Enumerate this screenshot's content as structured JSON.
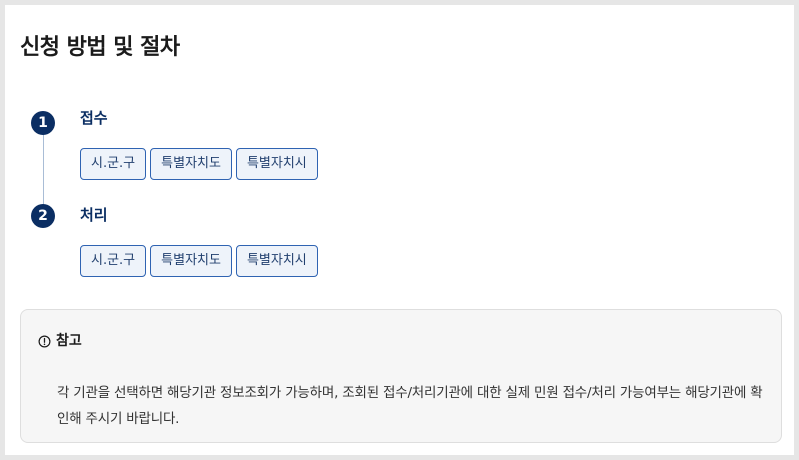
{
  "page_title": "신청 방법 및 절차",
  "steps": [
    {
      "number": "1",
      "title": "접수",
      "tags": [
        "시.군.구",
        "특별자치도",
        "특별자치시"
      ]
    },
    {
      "number": "2",
      "title": "처리",
      "tags": [
        "시.군.구",
        "특별자치도",
        "특별자치시"
      ]
    }
  ],
  "note": {
    "icon": "info-circle-icon",
    "title": "참고",
    "body": "각 기관을 선택하면 해당기관 정보조회가 가능하며, 조회된 접수/처리기관에 대한 실제 민원 접수/처리 가능여부는 해당기관에 확인해 주시기 바랍니다."
  },
  "colors": {
    "primary": "#0b2e63",
    "tag_border": "#2f63b2",
    "tag_background": "#eef3fa",
    "note_background": "#f6f6f6"
  }
}
